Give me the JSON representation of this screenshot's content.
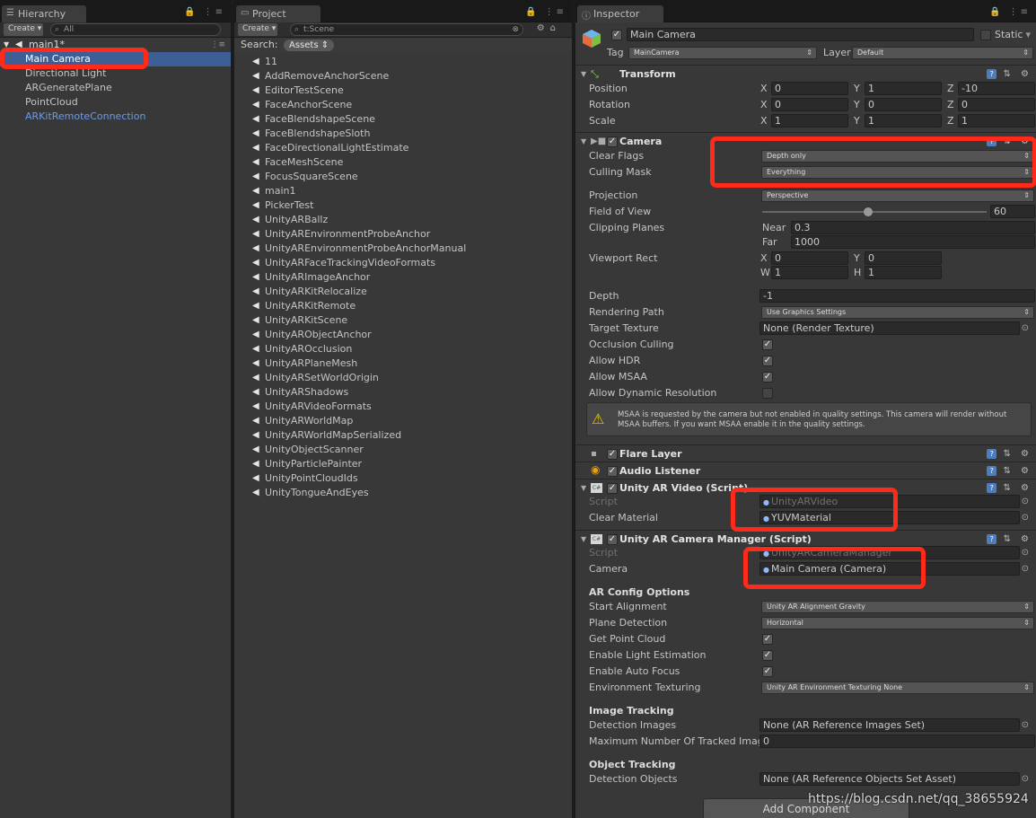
{
  "hierarchy": {
    "tab_title": "Hierarchy",
    "create_label": "Create",
    "search_placeholder": "All",
    "scene_name": "main1*",
    "items": [
      {
        "label": "Main Camera",
        "selected": true
      },
      {
        "label": "Directional Light"
      },
      {
        "label": "ARGeneratePlane"
      },
      {
        "label": "PointCloud"
      },
      {
        "label": "ARKitRemoteConnection",
        "color": "#6b9be8"
      }
    ]
  },
  "project": {
    "tab_title": "Project",
    "create_label": "Create",
    "search_value": "t:Scene",
    "search_label": "Search:",
    "assets_label": "Assets",
    "items": [
      "11",
      "AddRemoveAnchorScene",
      "EditorTestScene",
      "FaceAnchorScene",
      "FaceBlendshapeScene",
      "FaceBlendshapeSloth",
      "FaceDirectionalLightEstimate",
      "FaceMeshScene",
      "FocusSquareScene",
      "main1",
      "PickerTest",
      "UnityARBallz",
      "UnityAREnvironmentProbeAnchor",
      "UnityAREnvironmentProbeAnchorManual",
      "UnityARFaceTrackingVideoFormats",
      "UnityARImageAnchor",
      "UnityARKitRelocalize",
      "UnityARKitRemote",
      "UnityARKitScene",
      "UnityARObjectAnchor",
      "UnityAROcclusion",
      "UnityARPlaneMesh",
      "UnityARSetWorldOrigin",
      "UnityARShadows",
      "UnityARVideoFormats",
      "UnityARWorldMap",
      "UnityARWorldMapSerialized",
      "UnityObjectScanner",
      "UnityParticlePainter",
      "UnityPointCloudIds",
      "UnityTongueAndEyes"
    ]
  },
  "inspector": {
    "tab_title": "Inspector",
    "object_name": "Main Camera",
    "static_label": "Static",
    "tag_label": "Tag",
    "tag_value": "MainCamera",
    "layer_label": "Layer",
    "layer_value": "Default",
    "transform": {
      "title": "Transform",
      "position_label": "Position",
      "rotation_label": "Rotation",
      "scale_label": "Scale",
      "position": [
        "0",
        "1",
        "-10"
      ],
      "rotation": [
        "0",
        "0",
        "0"
      ],
      "scale": [
        "1",
        "1",
        "1"
      ],
      "x": "X",
      "y": "Y",
      "z": "Z"
    },
    "camera": {
      "title": "Camera",
      "clear_flags_label": "Clear Flags",
      "clear_flags": "Depth only",
      "culling_mask_label": "Culling Mask",
      "culling_mask": "Everything",
      "projection_label": "Projection",
      "projection": "Perspective",
      "fov_label": "Field of View",
      "fov": "60",
      "fov_fraction": 0.47,
      "clipping_label": "Clipping Planes",
      "near_label": "Near",
      "near": "0.3",
      "far_label": "Far",
      "far": "1000",
      "viewport_label": "Viewport Rect",
      "vx": "0",
      "vy": "0",
      "vw": "1",
      "vh": "1",
      "w": "W",
      "h": "H",
      "depth_label": "Depth",
      "depth": "-1",
      "rendering_path_label": "Rendering Path",
      "rendering_path": "Use Graphics Settings",
      "target_texture_label": "Target Texture",
      "target_texture": "None (Render Texture)",
      "occlusion_label": "Occlusion Culling",
      "occlusion": true,
      "hdr_label": "Allow HDR",
      "hdr": true,
      "msaa_label": "Allow MSAA",
      "msaa": true,
      "dynres_label": "Allow Dynamic Resolution",
      "dynres": false,
      "warning": "MSAA is requested by the camera but not enabled in quality settings. This camera will render without MSAA buffers. If you want MSAA enable it in the quality settings."
    },
    "flare_layer": "Flare Layer",
    "audio_listener": "Audio Listener",
    "ar_video": {
      "title": "Unity AR Video (Script)",
      "script_label": "Script",
      "script": "UnityARVideo",
      "clear_material_label": "Clear Material",
      "clear_material": "YUVMaterial"
    },
    "ar_cam_mgr": {
      "title": "Unity AR Camera Manager (Script)",
      "script_label": "Script",
      "script": "UnityARCameraManager",
      "camera_label": "Camera",
      "camera": "Main Camera (Camera)",
      "config_title": "AR Config Options",
      "start_alignment_label": "Start Alignment",
      "start_alignment": "Unity AR Alignment Gravity",
      "plane_detection_label": "Plane Detection",
      "plane_detection": "Horizontal",
      "point_cloud_label": "Get Point Cloud",
      "light_est_label": "Enable Light Estimation",
      "auto_focus_label": "Enable Auto Focus",
      "env_tex_label": "Environment Texturing",
      "env_tex": "Unity AR Environment Texturing None",
      "image_tracking_title": "Image Tracking",
      "detection_images_label": "Detection Images",
      "detection_images": "None (AR Reference Images Set)",
      "max_tracked_label": "Maximum Number Of Tracked Imag",
      "max_tracked": "0",
      "object_tracking_title": "Object Tracking",
      "detection_objects_label": "Detection Objects",
      "detection_objects": "None (AR Reference Objects Set Asset)"
    },
    "add_component": "Add Component"
  },
  "watermark": "https://blog.csdn.net/qq_38655924",
  "colors": {
    "highlight": "#ff2a1a",
    "link": "#6b9be8",
    "help": "#4b7dbf"
  }
}
